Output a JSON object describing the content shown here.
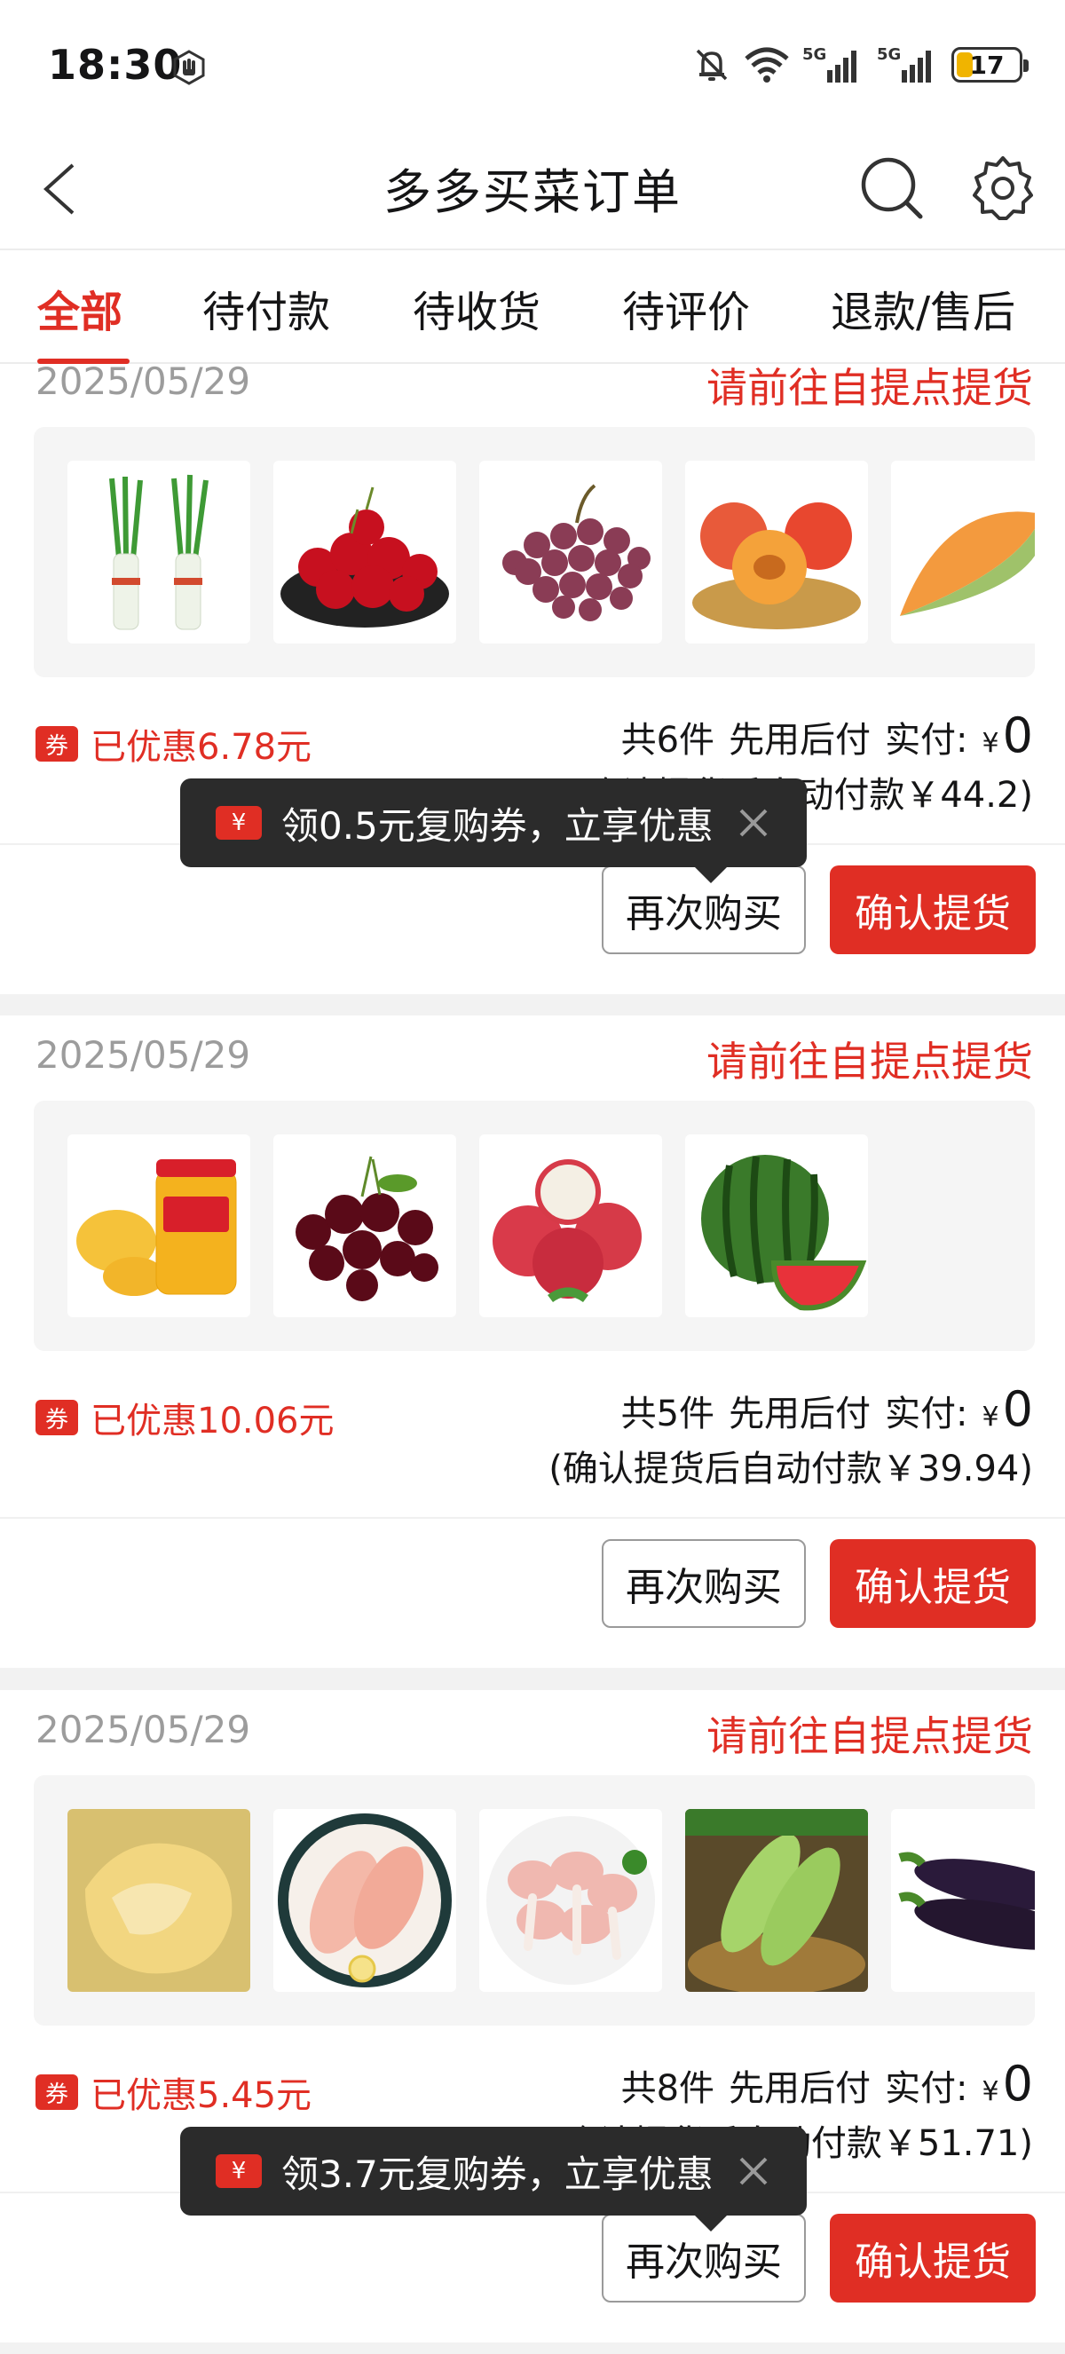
{
  "status_bar": {
    "time": "18:30",
    "battery": "17",
    "signal_1": "5G",
    "signal_2": "5G"
  },
  "nav": {
    "title": "多多买菜订单"
  },
  "tabs": [
    {
      "label": "全部",
      "active": true
    },
    {
      "label": "待付款",
      "active": false
    },
    {
      "label": "待收货",
      "active": false
    },
    {
      "label": "待评价",
      "active": false
    },
    {
      "label": "退款/售后",
      "active": false
    }
  ],
  "orders": [
    {
      "date": "2025/05/29",
      "status": "请前往自提点提货",
      "items": [
        "green-onion",
        "cherries",
        "grapes",
        "peaches",
        "cantaloupe"
      ],
      "coupon_tag": "券",
      "discount": "已优惠6.78元",
      "count": "共6件",
      "pay_mode": "先用后付",
      "paid_label": "实付:",
      "currency": "¥",
      "paid_amount": "0",
      "auto_pay": "(确认提货后自动付款￥44.2)",
      "rebuy_label": "再次购买",
      "confirm_label": "确认提货"
    },
    {
      "date": "2025/05/29",
      "status": "请前往自提点提货",
      "items": [
        "canned-yellow-peach",
        "dark-cherries",
        "lychee",
        "watermelon"
      ],
      "coupon_tag": "券",
      "discount": "已优惠10.06元",
      "count": "共5件",
      "pay_mode": "先用后付",
      "paid_label": "实付:",
      "currency": "¥",
      "paid_amount": "0",
      "auto_pay": "(确认提货后自动付款￥39.94)",
      "rebuy_label": "再次购买",
      "confirm_label": "确认提货"
    },
    {
      "date": "2025/05/29",
      "status": "请前往自提点提货",
      "items": [
        "fried-food",
        "chicken-breast",
        "chicken-drumsticks",
        "zucchini",
        "eggplant"
      ],
      "coupon_tag": "券",
      "discount": "已优惠5.45元",
      "count": "共8件",
      "pay_mode": "先用后付",
      "paid_label": "实付:",
      "currency": "¥",
      "paid_amount": "0",
      "auto_pay": "(确认提货后自动付款￥51.71)",
      "rebuy_label": "再次购买",
      "confirm_label": "确认提货"
    }
  ],
  "tooltips": [
    {
      "icon": "¥",
      "text": "领0.5元复购券，立享优惠"
    },
    {
      "icon": "¥",
      "text": "领3.7元复购券，立享优惠"
    }
  ],
  "colors": {
    "accent": "#e02e24",
    "muted": "#9c9c9c",
    "tooltip_bg": "#2b2b2b"
  }
}
